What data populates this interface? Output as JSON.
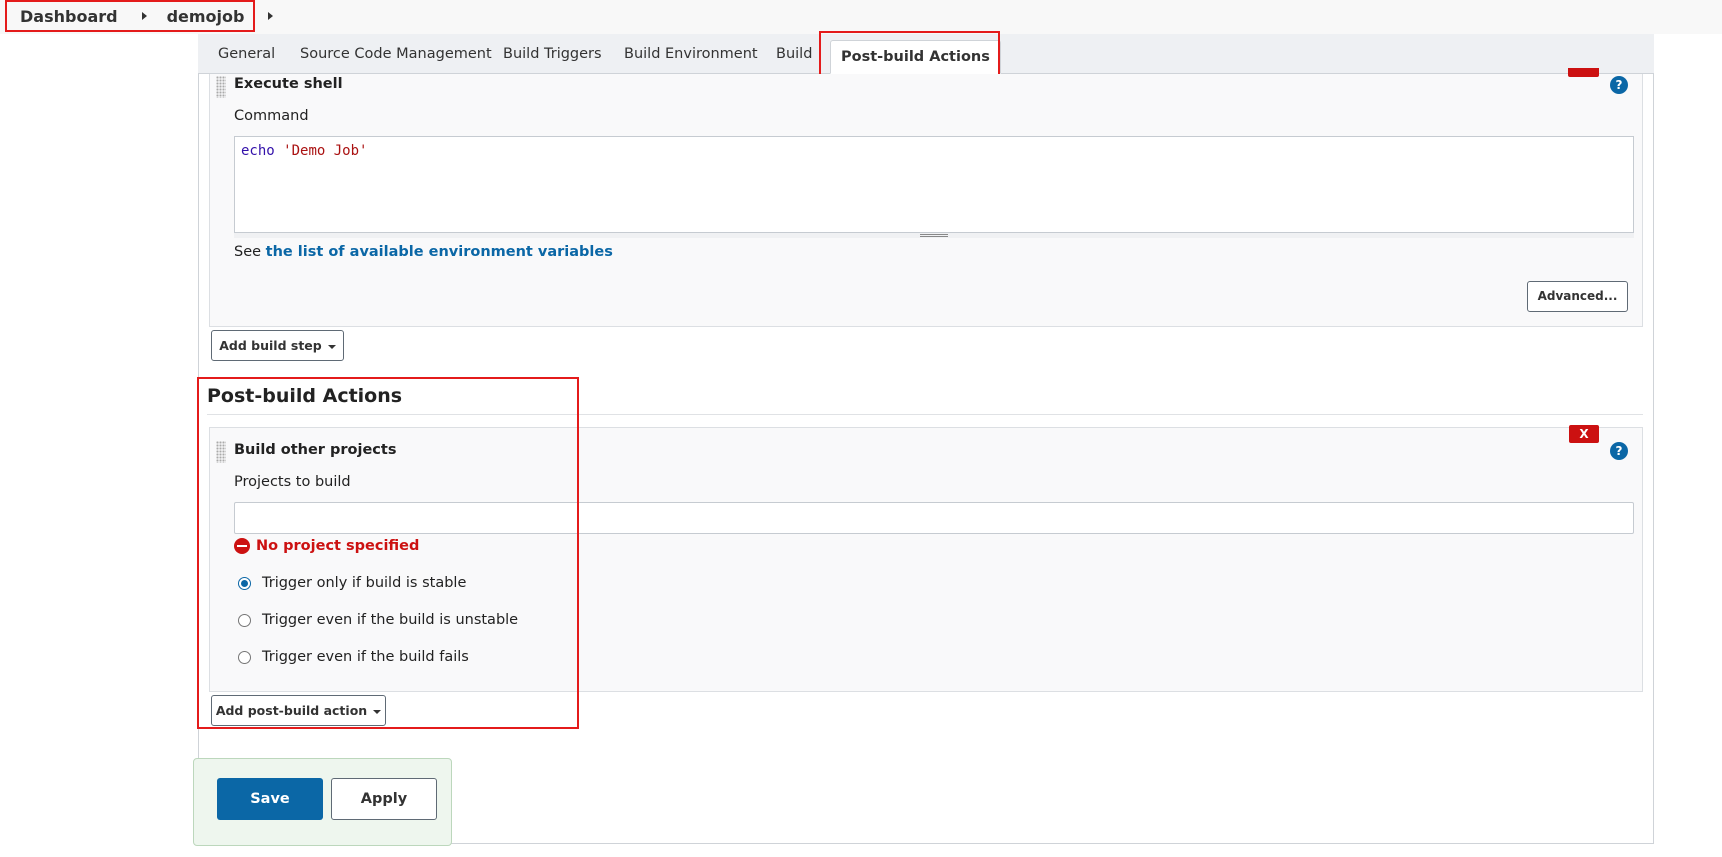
{
  "breadcrumb": {
    "items": [
      "Dashboard",
      "demojob"
    ]
  },
  "tabs": [
    "General",
    "Source Code Management",
    "Build Triggers",
    "Build Environment",
    "Build",
    "Post-build Actions"
  ],
  "active_tab": "Post-build Actions",
  "build_step": {
    "title": "Execute shell",
    "command_label": "Command",
    "command_keyword": "echo",
    "command_string": "'Demo Job'",
    "env_prefix": "See ",
    "env_link": "the list of available environment variables",
    "advanced_label": "Advanced...",
    "add_step_label": "Add build step"
  },
  "post_build": {
    "section_title": "Post-build Actions",
    "step_title": "Build other projects",
    "projects_label": "Projects to build",
    "projects_value": "",
    "error_text": "No project specified",
    "options": [
      {
        "label": "Trigger only if build is stable",
        "checked": true
      },
      {
        "label": "Trigger even if the build is unstable",
        "checked": false
      },
      {
        "label": "Trigger even if the build fails",
        "checked": false
      }
    ],
    "delete_label": "X",
    "add_action_label": "Add post-build action"
  },
  "help_label": "?",
  "footer": {
    "save_label": "Save",
    "apply_label": "Apply"
  },
  "colors": {
    "accent": "#0b67a6",
    "error": "#cc1111",
    "highlight": "#e41b1b"
  }
}
